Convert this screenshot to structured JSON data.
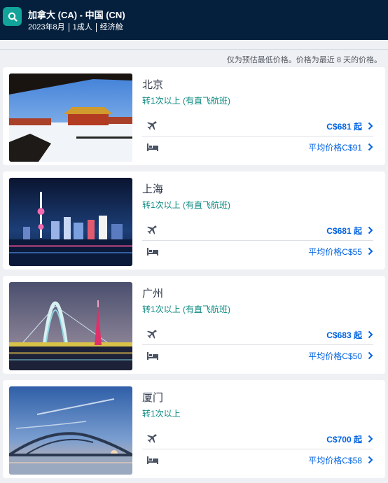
{
  "header": {
    "route": "加拿大 (CA) - 中国 (CN)",
    "date": "2023年8月",
    "travellers": "1成人",
    "cabin": "经济舱"
  },
  "notice": "仅为预估最低价格。价格为最近 8 天的价格。",
  "cards": [
    {
      "city": "北京",
      "stops": "转1次以上 (有直飞航班)",
      "flight_price": "C$681 起",
      "hotel_price": "平均价格C$91",
      "image": "beijing-forbidden-city-snow"
    },
    {
      "city": "上海",
      "stops": "转1次以上 (有直飞航班)",
      "flight_price": "C$681 起",
      "hotel_price": "平均价格C$55",
      "image": "shanghai-skyline-night"
    },
    {
      "city": "广州",
      "stops": "转1次以上 (有直飞航班)",
      "flight_price": "C$683 起",
      "hotel_price": "平均价格C$50",
      "image": "guangzhou-bridge-tower-night"
    },
    {
      "city": "厦门",
      "stops": "转1次以上",
      "flight_price": "C$700 起",
      "hotel_price": "平均价格C$58",
      "image": "xiamen-bridge-sunset"
    }
  ],
  "icons": {
    "search": "search-icon",
    "flight": "plane-icon",
    "hotel": "bed-icon",
    "more": "chevron-right-icon"
  },
  "colors": {
    "header_bg": "#05203c",
    "search_bg": "#12a49a",
    "link": "#0062e3",
    "stops": "#0b8a80"
  }
}
